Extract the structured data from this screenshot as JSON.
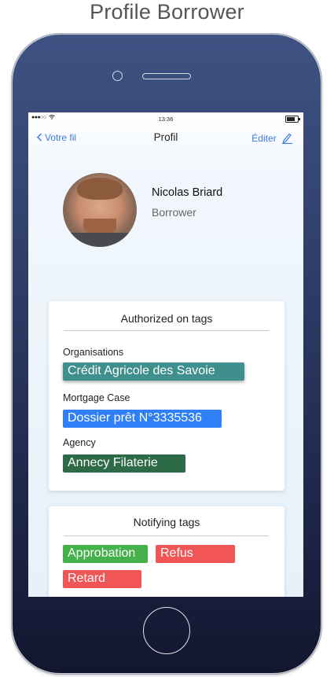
{
  "page": {
    "title": "Profile Borrower"
  },
  "status_bar": {
    "signal": "●●●○○",
    "time": "13:36"
  },
  "nav": {
    "back_label": "Votre fil",
    "title": "Profil",
    "edit_label": "Éditer"
  },
  "profile": {
    "name": "Nicolas Briard",
    "role": "Borrower"
  },
  "authorized_card": {
    "title": "Authorized on tags",
    "sections": [
      {
        "label": "Organisations",
        "tag": "Crédit Agricole des Savoie",
        "color": "#3f8f8d"
      },
      {
        "label": "Mortgage Case",
        "tag": "Dossier prêt N°3335536",
        "color": "#2f7ff6"
      },
      {
        "label": "Agency",
        "tag": "Annecy Filaterie",
        "color": "#2c6a48"
      }
    ]
  },
  "notifying_card": {
    "title": "Notifying tags",
    "tags": [
      {
        "label": "Approbation",
        "color": "#45b14a"
      },
      {
        "label": "Refus",
        "color": "#f25556"
      },
      {
        "label": "Retard",
        "color": "#f25556"
      }
    ]
  },
  "icons": {
    "back": "chevron-left-icon",
    "edit": "pencil-icon",
    "wifi": "wifi-icon",
    "battery": "battery-icon"
  }
}
